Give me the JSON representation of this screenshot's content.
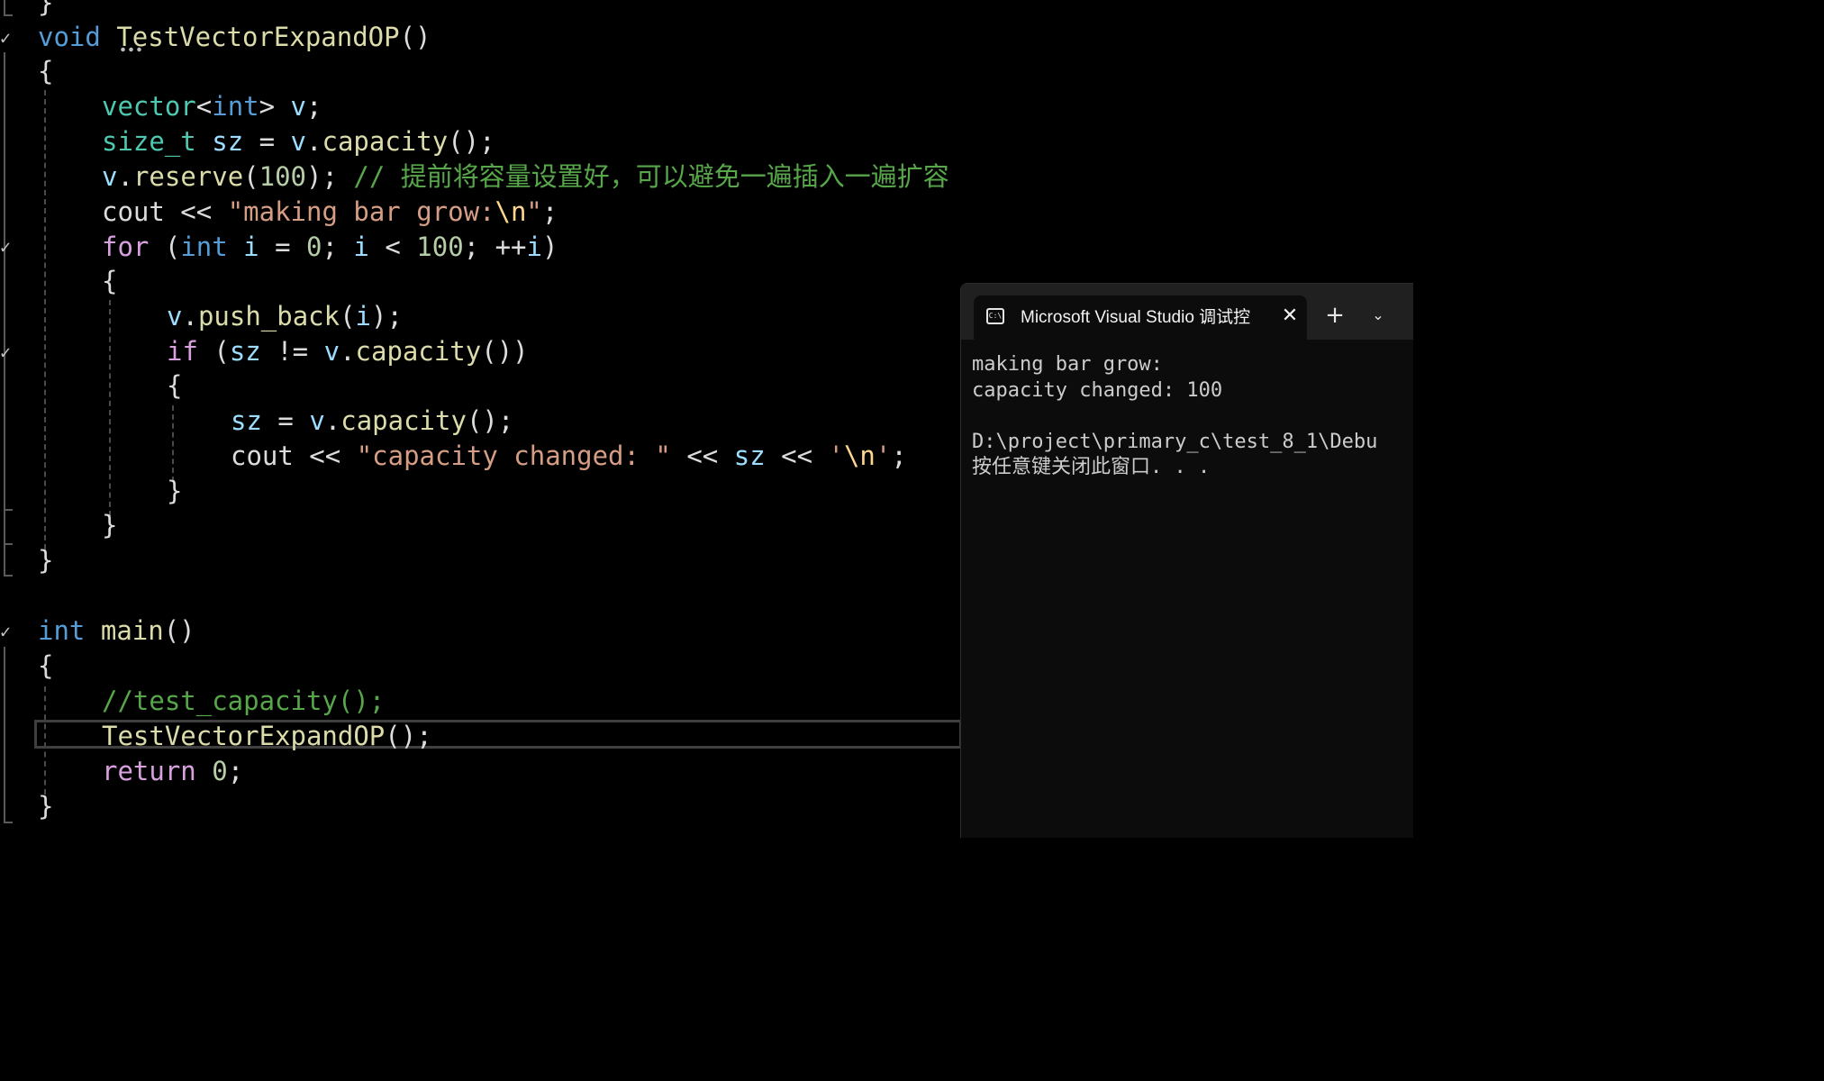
{
  "editor": {
    "lines": [
      {
        "tokens": [
          {
            "t": "}",
            "c": "pl"
          }
        ]
      },
      {
        "tokens": [
          {
            "t": "void",
            "c": "kw"
          },
          {
            "t": " ",
            "c": "pl"
          },
          {
            "t": "TestVectorExpandOP",
            "c": "fn"
          },
          {
            "t": "()",
            "c": "pl"
          }
        ]
      },
      {
        "tokens": [
          {
            "t": "{",
            "c": "pl"
          }
        ]
      },
      {
        "tokens": [
          {
            "t": "vector",
            "c": "typ"
          },
          {
            "t": "<",
            "c": "pl"
          },
          {
            "t": "int",
            "c": "kw"
          },
          {
            "t": "> ",
            "c": "pl"
          },
          {
            "t": "v",
            "c": "var"
          },
          {
            "t": ";",
            "c": "pl"
          }
        ]
      },
      {
        "tokens": [
          {
            "t": "size_t",
            "c": "typ"
          },
          {
            "t": " ",
            "c": "pl"
          },
          {
            "t": "sz",
            "c": "var"
          },
          {
            "t": " = ",
            "c": "pl"
          },
          {
            "t": "v",
            "c": "var"
          },
          {
            "t": ".",
            "c": "pl"
          },
          {
            "t": "capacity",
            "c": "fn"
          },
          {
            "t": "();",
            "c": "pl"
          }
        ]
      },
      {
        "tokens": [
          {
            "t": "v",
            "c": "var"
          },
          {
            "t": ".",
            "c": "pl"
          },
          {
            "t": "reserve",
            "c": "fn"
          },
          {
            "t": "(",
            "c": "pl"
          },
          {
            "t": "100",
            "c": "num"
          },
          {
            "t": "); ",
            "c": "pl"
          },
          {
            "t": "// 提前将容量设置好，可以避免一遍插入一遍扩容",
            "c": "cmt"
          }
        ]
      },
      {
        "tokens": [
          {
            "t": "cout",
            "c": "pl"
          },
          {
            "t": " << ",
            "c": "pl"
          },
          {
            "t": "\"making bar grow:",
            "c": "str"
          },
          {
            "t": "\\n",
            "c": "esc"
          },
          {
            "t": "\"",
            "c": "str"
          },
          {
            "t": ";",
            "c": "pl"
          }
        ]
      },
      {
        "tokens": [
          {
            "t": "for",
            "c": "ctl"
          },
          {
            "t": " (",
            "c": "pl"
          },
          {
            "t": "int",
            "c": "kw"
          },
          {
            "t": " ",
            "c": "pl"
          },
          {
            "t": "i",
            "c": "var"
          },
          {
            "t": " = ",
            "c": "pl"
          },
          {
            "t": "0",
            "c": "num"
          },
          {
            "t": "; ",
            "c": "pl"
          },
          {
            "t": "i",
            "c": "var"
          },
          {
            "t": " < ",
            "c": "pl"
          },
          {
            "t": "100",
            "c": "num"
          },
          {
            "t": "; ++",
            "c": "pl"
          },
          {
            "t": "i",
            "c": "var"
          },
          {
            "t": ")",
            "c": "pl"
          }
        ]
      },
      {
        "tokens": [
          {
            "t": "{",
            "c": "pl"
          }
        ]
      },
      {
        "tokens": [
          {
            "t": "v",
            "c": "var"
          },
          {
            "t": ".",
            "c": "pl"
          },
          {
            "t": "push_back",
            "c": "fn"
          },
          {
            "t": "(",
            "c": "pl"
          },
          {
            "t": "i",
            "c": "var"
          },
          {
            "t": ");",
            "c": "pl"
          }
        ]
      },
      {
        "tokens": [
          {
            "t": "if",
            "c": "ctl"
          },
          {
            "t": " (",
            "c": "pl"
          },
          {
            "t": "sz",
            "c": "var"
          },
          {
            "t": " != ",
            "c": "pl"
          },
          {
            "t": "v",
            "c": "var"
          },
          {
            "t": ".",
            "c": "pl"
          },
          {
            "t": "capacity",
            "c": "fn"
          },
          {
            "t": "())",
            "c": "pl"
          }
        ]
      },
      {
        "tokens": [
          {
            "t": "{",
            "c": "pl"
          }
        ]
      },
      {
        "tokens": [
          {
            "t": "sz",
            "c": "var"
          },
          {
            "t": " = ",
            "c": "pl"
          },
          {
            "t": "v",
            "c": "var"
          },
          {
            "t": ".",
            "c": "pl"
          },
          {
            "t": "capacity",
            "c": "fn"
          },
          {
            "t": "();",
            "c": "pl"
          }
        ]
      },
      {
        "tokens": [
          {
            "t": "cout",
            "c": "pl"
          },
          {
            "t": " << ",
            "c": "pl"
          },
          {
            "t": "\"capacity changed: \"",
            "c": "str"
          },
          {
            "t": " << ",
            "c": "pl"
          },
          {
            "t": "sz",
            "c": "var"
          },
          {
            "t": " << ",
            "c": "pl"
          },
          {
            "t": "'",
            "c": "str"
          },
          {
            "t": "\\n",
            "c": "esc"
          },
          {
            "t": "'",
            "c": "str"
          },
          {
            "t": ";",
            "c": "pl"
          }
        ]
      },
      {
        "tokens": [
          {
            "t": "}",
            "c": "pl"
          }
        ]
      },
      {
        "tokens": [
          {
            "t": "}",
            "c": "pl"
          }
        ]
      },
      {
        "tokens": [
          {
            "t": "}",
            "c": "pl"
          }
        ]
      },
      {
        "tokens": [
          {
            "t": "int",
            "c": "kw"
          },
          {
            "t": " ",
            "c": "pl"
          },
          {
            "t": "main",
            "c": "fn"
          },
          {
            "t": "()",
            "c": "pl"
          }
        ]
      },
      {
        "tokens": [
          {
            "t": "{",
            "c": "pl"
          }
        ]
      },
      {
        "tokens": [
          {
            "t": "//test_capacity();",
            "c": "cmt"
          }
        ]
      },
      {
        "tokens": [
          {
            "t": "TestVectorExpandOP",
            "c": "fn"
          },
          {
            "t": "();",
            "c": "pl"
          }
        ]
      },
      {
        "tokens": [
          {
            "t": "return",
            "c": "ctl"
          },
          {
            "t": " ",
            "c": "pl"
          },
          {
            "t": "0",
            "c": "num"
          },
          {
            "t": ";",
            "c": "pl"
          }
        ]
      },
      {
        "tokens": [
          {
            "t": "}",
            "c": "pl"
          }
        ]
      }
    ],
    "fold_marker": "✓"
  },
  "console": {
    "tab_icon_text": "C:\\",
    "tab_title": "Microsoft Visual Studio 调试控",
    "close_glyph": "✕",
    "new_tab_glyph": "+",
    "dropdown_glyph": "⌄",
    "output": [
      "making bar grow:",
      "capacity changed: 100",
      "",
      "D:\\project\\primary_c\\test_8_1\\Debu",
      "按任意键关闭此窗口. . ."
    ]
  }
}
